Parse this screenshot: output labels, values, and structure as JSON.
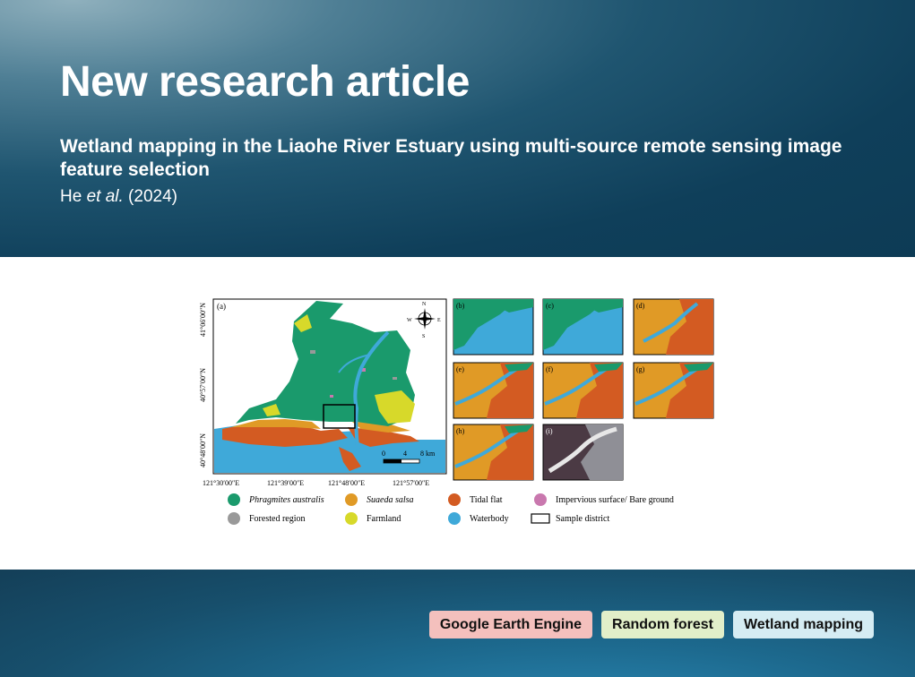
{
  "header": {
    "title": "New research article",
    "subtitle": "Wetland mapping in the Liaohe River Estuary using multi-source remote sensing image feature selection",
    "authors_prefix": "He ",
    "authors_etal": "et al.",
    "authors_year": " (2024)"
  },
  "figure": {
    "panel_labels": [
      "(a)",
      "(b)",
      "(c)",
      "(d)",
      "(e)",
      "(f)",
      "(g)",
      "(h)",
      "(i)"
    ],
    "lat_labels": [
      "41°06′00″N",
      "40°57′00″N",
      "40°48′00″N"
    ],
    "lon_labels": [
      "121°30′00″E",
      "121°39′00″E",
      "121°48′00″E",
      "121°57′00″E"
    ],
    "compass": {
      "n": "N",
      "s": "S",
      "e": "E",
      "w": "W"
    },
    "scalebar": {
      "t0": "0",
      "t1": "4",
      "t2": "8 km"
    },
    "legend": [
      {
        "label": "Phragmites australis",
        "color": "#1a9a6c",
        "italic": true
      },
      {
        "label": "Suaeda salsa",
        "color": "#e09a26",
        "italic": true
      },
      {
        "label": "Tidal flat",
        "color": "#d35b22",
        "italic": false
      },
      {
        "label": "Impervious surface/ Bare ground",
        "color": "#c978ae",
        "italic": false
      },
      {
        "label": "Forested region",
        "color": "#999999",
        "italic": false
      },
      {
        "label": "Farmland",
        "color": "#d7d92a",
        "italic": false
      },
      {
        "label": "Waterbody",
        "color": "#3fa9d9",
        "italic": false
      },
      {
        "label": "Sample district",
        "color": "#000000",
        "italic": false
      }
    ]
  },
  "tags": [
    {
      "label": "Google Earth Engine",
      "color": "#f4c0bd"
    },
    {
      "label": "Random forest",
      "color": "#e2efc9"
    },
    {
      "label": "Wetland mapping",
      "color": "#d5ecf3"
    }
  ]
}
